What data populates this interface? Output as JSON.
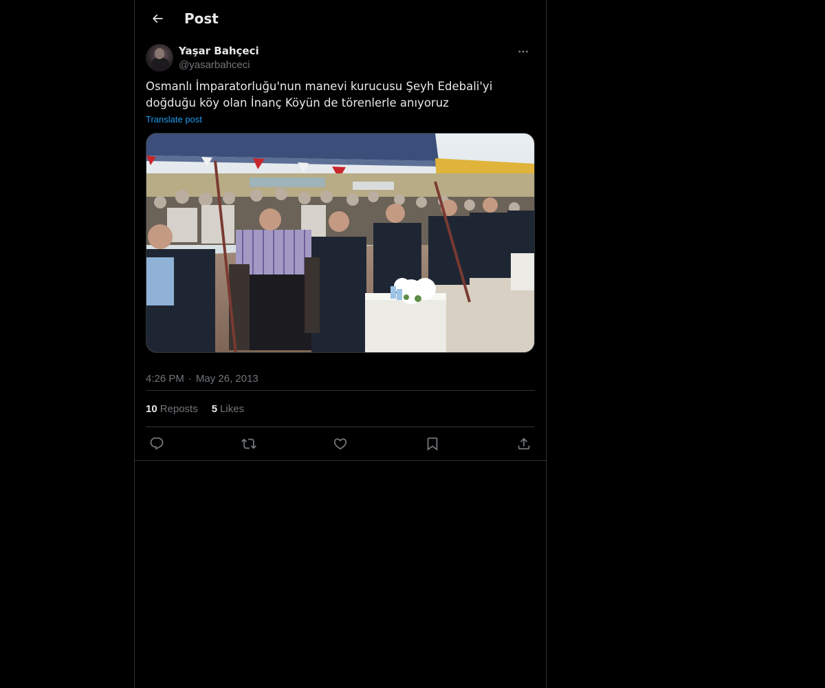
{
  "header": {
    "title": "Post"
  },
  "post": {
    "author": {
      "display_name": "Yaşar Bahçeci",
      "handle": "@yasarbahceci"
    },
    "text": "Osmanlı İmparatorluğu'nun manevi kurucusu Şeyh Edebali'yi doğduğu köy olan İnanç Köyün de törenlerle anıyoruz",
    "translate_label": "Translate post",
    "time": "4:26 PM",
    "date": "May 26, 2013",
    "separator": "·",
    "reposts": {
      "count": "10",
      "label": "Reposts"
    },
    "likes": {
      "count": "5",
      "label": "Likes"
    }
  },
  "icons": {
    "back": "back-arrow-icon",
    "more": "more-icon",
    "reply": "reply-icon",
    "repost": "repost-icon",
    "like": "like-icon",
    "bookmark": "bookmark-icon",
    "share": "share-icon"
  },
  "colors": {
    "background": "#000000",
    "border": "#2f3336",
    "text_primary": "#e7e9ea",
    "text_secondary": "#71767b",
    "accent": "#1d9bf0"
  }
}
